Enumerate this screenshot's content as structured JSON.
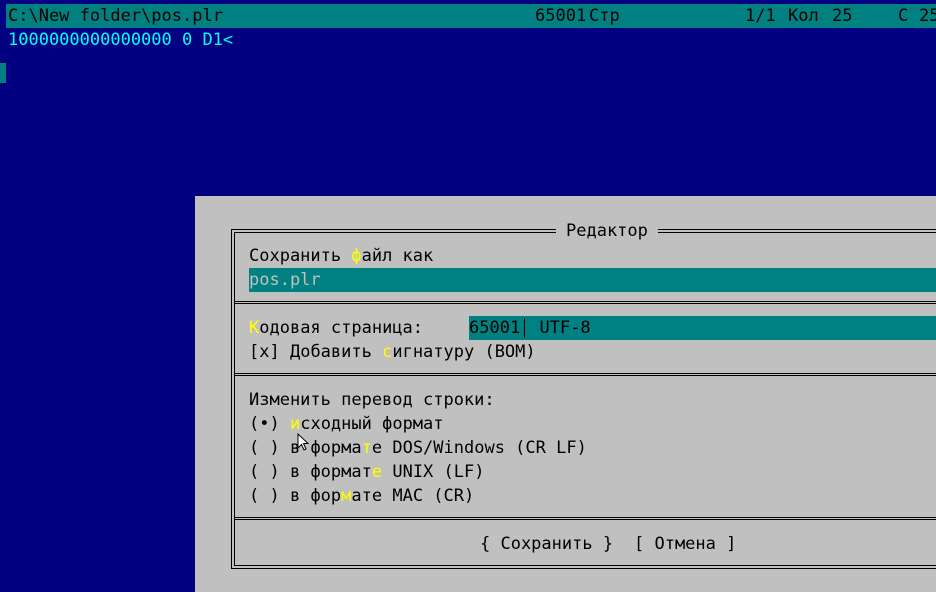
{
  "titlebar": {
    "path": "C:\\New folder\\pos.plr",
    "codepage": "65001",
    "page_label": "Стр",
    "position": "1/1",
    "col_label": "Кол",
    "col_value": "25",
    "char_label": "С",
    "char_value": "25"
  },
  "editor": {
    "line1": "1000000000000000 0 D1<"
  },
  "dialog": {
    "title": "Редактор",
    "save_as": {
      "label_pre": "Сохранить ",
      "label_hot": "ф",
      "label_post": "айл как",
      "filename": "pos.plr"
    },
    "codepage": {
      "label_hot": "К",
      "label_post": "одовая страница:",
      "number": "65001",
      "name": "UTF-8"
    },
    "bom": {
      "check": "[x]",
      "label_pre": "Добавить ",
      "label_hot": "с",
      "label_post": "игнатуру (BOM)"
    },
    "lineend": {
      "heading": "Изменить перевод строки:",
      "options": [
        {
          "mark": "(•)",
          "pre": "",
          "hot": "и",
          "post": "сходный формат"
        },
        {
          "mark": "( )",
          "pre": "в форма",
          "hot": "т",
          "post": "е DOS/Windows (CR LF)"
        },
        {
          "mark": "( )",
          "pre": "в формат",
          "hot": "е",
          "post": " UNIX (LF)"
        },
        {
          "mark": "( )",
          "pre": "в фор",
          "hot": "м",
          "post": "ате MAC (CR)"
        }
      ]
    },
    "buttons": {
      "save": "{ Сохранить }",
      "cancel": "[ Отмена ]"
    }
  },
  "colors": {
    "background": "#000080",
    "accent": "#008080",
    "dialog": "#c0c0c0",
    "hotkey": "#ffff00",
    "text_cyan": "#00ffff"
  },
  "icons": {
    "cursor": "mouse-pointer-icon"
  }
}
